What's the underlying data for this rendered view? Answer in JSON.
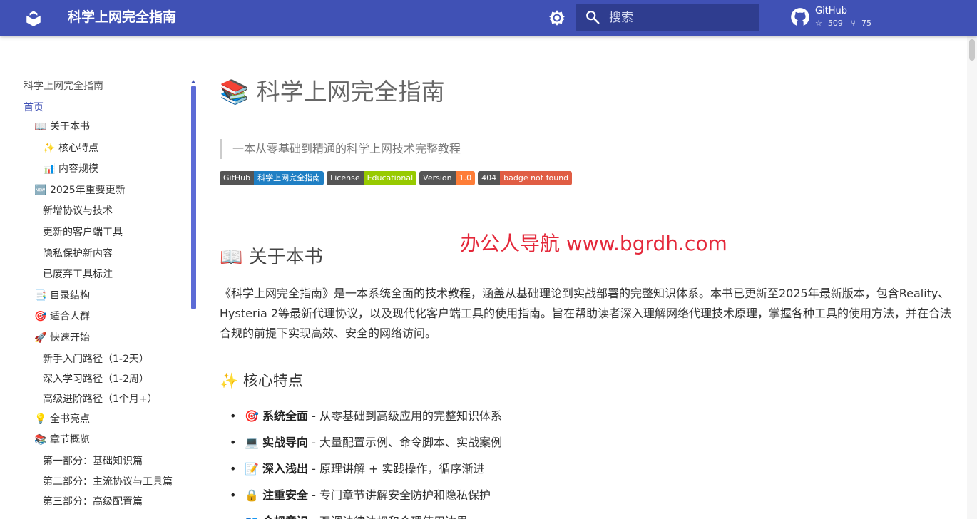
{
  "header": {
    "site_title": "科学上网完全指南",
    "search_placeholder": "搜索",
    "repo_name": "GitHub",
    "stars": "509",
    "forks": "75"
  },
  "sidebar": {
    "title": "科学上网完全指南",
    "home": "首页",
    "items": [
      {
        "icon": "📖",
        "label": "关于本书",
        "level": 1
      },
      {
        "icon": "✨",
        "label": "核心特点",
        "level": 2
      },
      {
        "icon": "📊",
        "label": "内容规模",
        "level": 2
      },
      {
        "icon": "🆕",
        "label": "2025年重要更新",
        "level": 1
      },
      {
        "icon": "",
        "label": "新增协议与技术",
        "level": 2
      },
      {
        "icon": "",
        "label": "更新的客户端工具",
        "level": 2
      },
      {
        "icon": "",
        "label": "隐私保护新内容",
        "level": 2
      },
      {
        "icon": "",
        "label": "已废弃工具标注",
        "level": 2
      },
      {
        "icon": "📑",
        "label": "目录结构",
        "level": 1
      },
      {
        "icon": "🎯",
        "label": "适合人群",
        "level": 1
      },
      {
        "icon": "🚀",
        "label": "快速开始",
        "level": 1
      },
      {
        "icon": "",
        "label": "新手入门路径（1-2天）",
        "level": 2
      },
      {
        "icon": "",
        "label": "深入学习路径（1-2周）",
        "level": 2
      },
      {
        "icon": "",
        "label": "高级进阶路径（1个月+）",
        "level": 2
      },
      {
        "icon": "💡",
        "label": "全书亮点",
        "level": 1
      },
      {
        "icon": "📚",
        "label": "章节概览",
        "level": 1
      },
      {
        "icon": "",
        "label": "第一部分：基础知识篇",
        "level": 2
      },
      {
        "icon": "",
        "label": "第二部分：主流协议与工具篇",
        "level": 2
      },
      {
        "icon": "",
        "label": "第三部分：高级配置篇",
        "level": 2
      }
    ]
  },
  "main": {
    "title_icon": "📚",
    "title": "科学上网完全指南",
    "subtitle": "一本从零基础到精通的科学上网技术完整教程",
    "badges": [
      {
        "label": "GitHub",
        "value": "科学上网完全指南",
        "color": "#1f7fc4"
      },
      {
        "label": "License",
        "value": "Educational",
        "color": "#97ca00"
      },
      {
        "label": "Version",
        "value": "1.0",
        "color": "#fe7d37"
      },
      {
        "label": "404",
        "value": "badge not found",
        "color": "#e05d44"
      }
    ],
    "watermark": "办公人导航  www.bgrdh.com",
    "section_icon": "📖",
    "section_title": "关于本书",
    "paragraph": "《科学上网完全指南》是一本系统全面的技术教程，涵盖从基础理论到实战部署的完整知识体系。本书已更新至2025年最新版本，包含Reality、Hysteria 2等最新代理协议，以及现代化客户端工具的使用指南。旨在帮助读者深入理解网络代理技术原理，掌握各种工具的使用方法，并在合法合规的前提下实现高效、安全的网络访问。",
    "sub_icon": "✨",
    "sub_title": "核心特点",
    "features": [
      {
        "icon": "🎯",
        "bold": "系统全面",
        "text": " - 从零基础到高级应用的完整知识体系"
      },
      {
        "icon": "💻",
        "bold": "实战导向",
        "text": " - 大量配置示例、命令脚本、实战案例"
      },
      {
        "icon": "📝",
        "bold": "深入浅出",
        "text": " - 原理讲解 + 实践操作，循序渐进"
      },
      {
        "icon": "🔒",
        "bold": "注重安全",
        "text": " - 专门章节讲解安全防护和隐私保护"
      },
      {
        "icon": "👥",
        "bold": "合规意识",
        "text": " - 强调法律法规和合理使用边界"
      }
    ]
  }
}
